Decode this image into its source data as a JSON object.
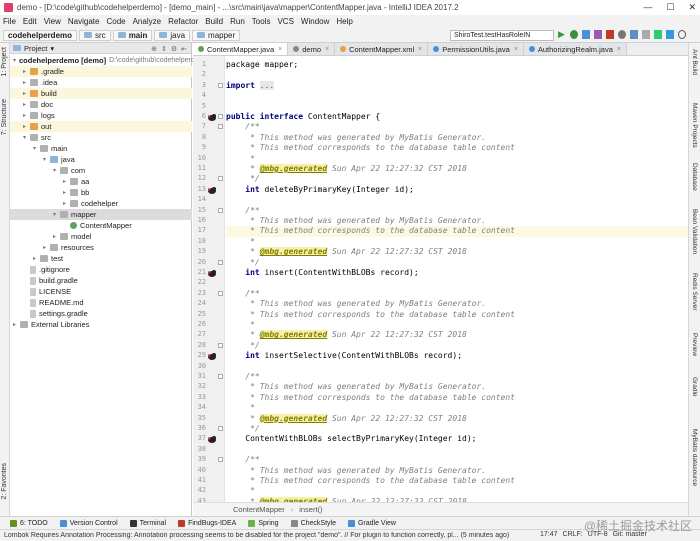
{
  "window": {
    "title": "demo - [D:\\code\\github\\codehelperdemo] - [demo_main] - ...\\src\\main\\java\\mapper\\ContentMapper.java - IntelliJ IDEA 2017.2",
    "controls": [
      "—",
      "☐",
      "✕"
    ]
  },
  "menu": [
    "File",
    "Edit",
    "View",
    "Navigate",
    "Code",
    "Analyze",
    "Refactor",
    "Build",
    "Run",
    "Tools",
    "VCS",
    "Window",
    "Help"
  ],
  "breadcrumb": [
    "codehelperdemo",
    "src",
    "main",
    "java",
    "mapper"
  ],
  "run_config": "ShiroTest.testHasRoleIN",
  "left_strip": [
    "1: Project",
    "7: Structure",
    "2: Favorites"
  ],
  "right_strip": [
    "Ant Build",
    "Maven Projects",
    "Database",
    "Bean Validation",
    "Redis Server",
    "Preview",
    "Gradle",
    "MyBatis datasource"
  ],
  "project": {
    "header": "Project",
    "tree": [
      {
        "label": "codehelperdemo [demo]",
        "extra": "D:\\code\\github\\codehelperdemo",
        "depth": 0,
        "arrow": "▾",
        "icon": "f-blue",
        "bold": true
      },
      {
        "label": ".gradle",
        "depth": 1,
        "arrow": "▸",
        "icon": "f-orange",
        "yellow": true
      },
      {
        "label": ".idea",
        "depth": 1,
        "arrow": "▸",
        "icon": "f-gray"
      },
      {
        "label": "build",
        "depth": 1,
        "arrow": "▸",
        "icon": "f-orange",
        "yellow": true
      },
      {
        "label": "doc",
        "depth": 1,
        "arrow": "▸",
        "icon": "f-gray"
      },
      {
        "label": "logs",
        "depth": 1,
        "arrow": "▸",
        "icon": "f-gray"
      },
      {
        "label": "out",
        "depth": 1,
        "arrow": "▸",
        "icon": "f-orange",
        "yellow": true
      },
      {
        "label": "src",
        "depth": 1,
        "arrow": "▾",
        "icon": "f-gray"
      },
      {
        "label": "main",
        "depth": 2,
        "arrow": "▾",
        "icon": "f-gray"
      },
      {
        "label": "java",
        "depth": 3,
        "arrow": "▾",
        "icon": "f-blue"
      },
      {
        "label": "com",
        "depth": 4,
        "arrow": "▾",
        "icon": "f-gray"
      },
      {
        "label": "aa",
        "depth": 5,
        "arrow": "▸",
        "icon": "f-gray"
      },
      {
        "label": "bb",
        "depth": 5,
        "arrow": "▸",
        "icon": "f-gray"
      },
      {
        "label": "codehelper",
        "depth": 5,
        "arrow": "▸",
        "icon": "f-gray"
      },
      {
        "label": "mapper",
        "depth": 4,
        "arrow": "▾",
        "icon": "f-gray",
        "selected": true
      },
      {
        "label": "ContentMapper",
        "depth": 5,
        "arrow": "",
        "icon": "f-iface"
      },
      {
        "label": "model",
        "depth": 4,
        "arrow": "▸",
        "icon": "f-gray"
      },
      {
        "label": "resources",
        "depth": 3,
        "arrow": "▸",
        "icon": "f-gray"
      },
      {
        "label": "test",
        "depth": 2,
        "arrow": "▸",
        "icon": "f-gray"
      },
      {
        "label": ".gitignore",
        "depth": 1,
        "arrow": "",
        "icon": "f-file"
      },
      {
        "label": "build.gradle",
        "depth": 1,
        "arrow": "",
        "icon": "f-file"
      },
      {
        "label": "LICENSE",
        "depth": 1,
        "arrow": "",
        "icon": "f-file"
      },
      {
        "label": "README.md",
        "depth": 1,
        "arrow": "",
        "icon": "f-file"
      },
      {
        "label": "settings.gradle",
        "depth": 1,
        "arrow": "",
        "icon": "f-file"
      },
      {
        "label": "External Libraries",
        "depth": 0,
        "arrow": "▸",
        "icon": "f-gray"
      }
    ]
  },
  "tabs": [
    {
      "label": "ContentMapper.java",
      "active": true,
      "color": "#5fa05f"
    },
    {
      "label": "demo",
      "active": false,
      "color": "#888888"
    },
    {
      "label": "ContentMapper.xml",
      "active": false,
      "color": "#e8a04a"
    },
    {
      "label": "PermissionUtils.java",
      "active": false,
      "color": "#4a90d9"
    },
    {
      "label": "AuthorizingRealm.java",
      "active": false,
      "color": "#4a90d9"
    }
  ],
  "code": {
    "start_line": 1,
    "highlight_line": 17,
    "marker_lines": [
      6,
      13,
      21,
      29,
      37
    ],
    "lines": [
      [
        [
          "package mapper;",
          ""
        ]
      ],
      [
        [
          "",
          ""
        ]
      ],
      [
        [
          "import ",
          "kw"
        ],
        [
          "...",
          "fold-c"
        ]
      ],
      [
        [
          "",
          ""
        ]
      ],
      [
        [
          "",
          ""
        ]
      ],
      [
        [
          "public interface ",
          "kw"
        ],
        [
          "ContentMapper {",
          ""
        ]
      ],
      [
        [
          "    /**",
          "cm"
        ]
      ],
      [
        [
          "     * This method was generated by MyBatis Generator.",
          "cm"
        ]
      ],
      [
        [
          "     * This method corresponds to the database table content",
          "cm"
        ]
      ],
      [
        [
          "     *",
          "cm"
        ]
      ],
      [
        [
          "     * ",
          "cm"
        ],
        [
          "@mbg.generated",
          "ann"
        ],
        [
          " Sun Apr 22 12:27:32 CST 2018",
          "cm"
        ]
      ],
      [
        [
          "     */",
          "cm"
        ]
      ],
      [
        [
          "    int ",
          "kw"
        ],
        [
          "deleteByPrimaryKey(Integer id);",
          ""
        ]
      ],
      [
        [
          "",
          ""
        ]
      ],
      [
        [
          "    /**",
          "cm"
        ]
      ],
      [
        [
          "     * This method was generated by MyBatis Generator.",
          "cm"
        ]
      ],
      [
        [
          "     * This method corresponds to the database table content",
          "cm"
        ]
      ],
      [
        [
          "     *",
          "cm"
        ]
      ],
      [
        [
          "     * ",
          "cm"
        ],
        [
          "@mbg.generated",
          "ann"
        ],
        [
          " Sun Apr 22 12:27:32 CST 2018",
          "cm"
        ]
      ],
      [
        [
          "     */",
          "cm"
        ]
      ],
      [
        [
          "    int ",
          "kw"
        ],
        [
          "insert(ContentWithBLOBs record);",
          ""
        ]
      ],
      [
        [
          "",
          ""
        ]
      ],
      [
        [
          "    /**",
          "cm"
        ]
      ],
      [
        [
          "     * This method was generated by MyBatis Generator.",
          "cm"
        ]
      ],
      [
        [
          "     * This method corresponds to the database table content",
          "cm"
        ]
      ],
      [
        [
          "     *",
          "cm"
        ]
      ],
      [
        [
          "     * ",
          "cm"
        ],
        [
          "@mbg.generated",
          "ann"
        ],
        [
          " Sun Apr 22 12:27:32 CST 2018",
          "cm"
        ]
      ],
      [
        [
          "     */",
          "cm"
        ]
      ],
      [
        [
          "    int ",
          "kw"
        ],
        [
          "insertSelective(ContentWithBLOBs record);",
          ""
        ]
      ],
      [
        [
          "",
          ""
        ]
      ],
      [
        [
          "    /**",
          "cm"
        ]
      ],
      [
        [
          "     * This method was generated by MyBatis Generator.",
          "cm"
        ]
      ],
      [
        [
          "     * This method corresponds to the database table content",
          "cm"
        ]
      ],
      [
        [
          "     *",
          "cm"
        ]
      ],
      [
        [
          "     * ",
          "cm"
        ],
        [
          "@mbg.generated",
          "ann"
        ],
        [
          " Sun Apr 22 12:27:32 CST 2018",
          "cm"
        ]
      ],
      [
        [
          "     */",
          "cm"
        ]
      ],
      [
        [
          "    ContentWithBLOBs selectByPrimaryKey(Integer id);",
          ""
        ]
      ],
      [
        [
          "",
          ""
        ]
      ],
      [
        [
          "    /**",
          "cm"
        ]
      ],
      [
        [
          "     * This method was generated by MyBatis Generator.",
          "cm"
        ]
      ],
      [
        [
          "     * This method corresponds to the database table content",
          "cm"
        ]
      ],
      [
        [
          "     *",
          "cm"
        ]
      ],
      [
        [
          "     * ",
          "cm"
        ],
        [
          "@mbg.generated",
          "ann"
        ],
        [
          " Sun Apr 22 12:27:32 CST 2018",
          "cm"
        ]
      ],
      [
        [
          "     */",
          "cm"
        ]
      ]
    ]
  },
  "editor_breadcrumb": [
    "ContentMapper",
    "insert()"
  ],
  "tool_windows": [
    {
      "label": "6: TODO",
      "color": "#6b8e23"
    },
    {
      "label": "Version Control",
      "color": "#4a90d9"
    },
    {
      "label": "Terminal",
      "color": "#333333"
    },
    {
      "label": "FindBugs-IDEA",
      "color": "#c0392b"
    },
    {
      "label": "Spring",
      "color": "#6ab04c"
    },
    {
      "label": "CheckStyle",
      "color": "#888888"
    },
    {
      "label": "Gradle View",
      "color": "#4a90d9"
    }
  ],
  "status": {
    "message": "Lombok Requires Annotation Processing: Annotation processing seems to be disabled for the project \"demo\". // For plugin to function correctly, pl... (5 minutes ago)",
    "position": "17:47",
    "line_sep": "CRLF:",
    "encoding": "UTF-8",
    "vcs": "Git: master"
  },
  "watermark": "@稀土掘金技术社区"
}
